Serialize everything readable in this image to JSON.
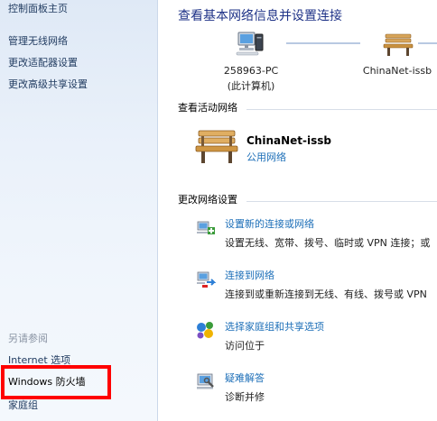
{
  "sidebar": {
    "items": [
      {
        "label": "控制面板主页"
      },
      {
        "label": "管理无线网络"
      },
      {
        "label": "更改适配器设置"
      },
      {
        "label": "更改高级共享设置"
      }
    ],
    "see_also": {
      "heading": "另请参阅",
      "items": [
        {
          "label": "Internet 选项"
        },
        {
          "label": "Windows 防火墙"
        },
        {
          "label": "家庭组"
        }
      ]
    },
    "highlight_color": "#ff0000"
  },
  "main": {
    "title": "查看基本网络信息并设置连接",
    "map": {
      "computer": {
        "name": "258963-PC",
        "subtitle": "(此计算机)",
        "icon": "computer-icon"
      },
      "network": {
        "name": "ChinaNet-issb",
        "icon": "bench-icon"
      }
    },
    "active_networks": {
      "label": "查看活动网络",
      "network_name": "ChinaNet-issb",
      "network_type": "公用网络"
    },
    "change_settings": {
      "label": "更改网络设置",
      "tasks": [
        {
          "link": "设置新的连接或网络",
          "desc": "设置无线、宽带、拨号、临时或 VPN 连接；或",
          "icon": "new-connection-icon"
        },
        {
          "link": "连接到网络",
          "desc": "连接到或重新连接到无线、有线、拨号或 VPN",
          "icon": "connect-network-icon"
        },
        {
          "link": "选择家庭组和共享选项",
          "desc": "访问位于",
          "icon": "homegroup-icon"
        },
        {
          "link": "疑难解答",
          "desc": "诊断并修",
          "icon": "troubleshoot-icon"
        }
      ]
    },
    "link_color": "#1d6fb8",
    "title_color": "#1e3287"
  }
}
